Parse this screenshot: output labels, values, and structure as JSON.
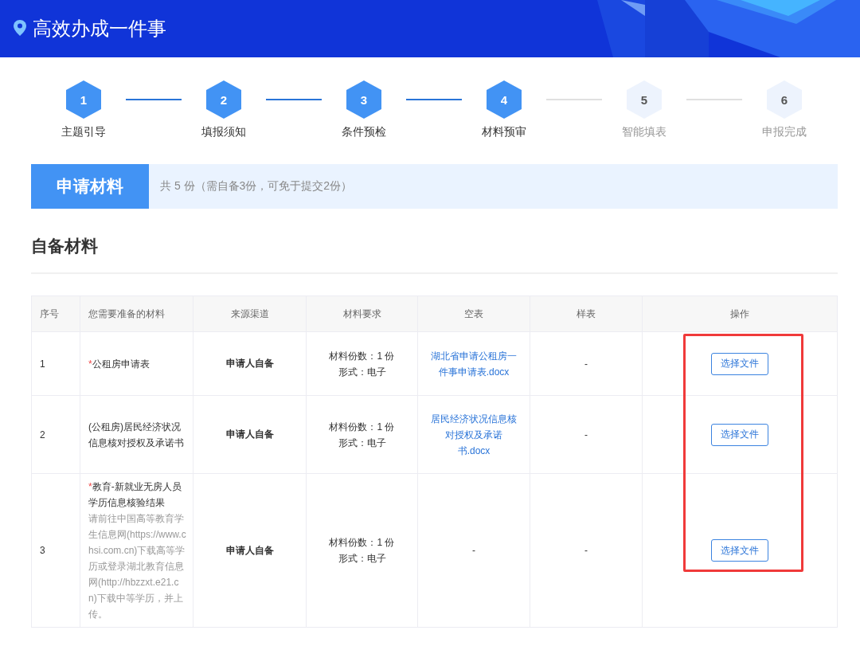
{
  "header": {
    "title": "高效办成一件事"
  },
  "steps": [
    {
      "number": "1",
      "label": "主题引导",
      "done": true
    },
    {
      "number": "2",
      "label": "填报须知",
      "done": true
    },
    {
      "number": "3",
      "label": "条件预检",
      "done": true
    },
    {
      "number": "4",
      "label": "材料预审",
      "done": true
    },
    {
      "number": "5",
      "label": "智能填表",
      "done": false
    },
    {
      "number": "6",
      "label": "申报完成",
      "done": false
    }
  ],
  "section": {
    "tab": "申请材料",
    "summary": "共 5 份（需自备3份，可免于提交2份）"
  },
  "subsection_title": "自备材料",
  "table": {
    "columns": [
      "序号",
      "您需要准备的材料",
      "来源渠道",
      "材料要求",
      "空表",
      "样表",
      "操作"
    ],
    "highlight_actions": true,
    "required_mark": "*",
    "rows": [
      {
        "index": "1",
        "required": true,
        "name": "公租房申请表",
        "note": "",
        "source": "申请人自备",
        "requirement": [
          "材料份数：1 份",
          "形式：电子"
        ],
        "blank_form": {
          "text": "湖北省申请公租房一件事申请表.docx",
          "kind": "link"
        },
        "sample": "-",
        "action": "选择文件"
      },
      {
        "index": "2",
        "required": false,
        "name": " (公租房)居民经济状况信息核对授权及承诺书",
        "note": "",
        "source": "申请人自备",
        "requirement": [
          "材料份数：1 份",
          "形式：电子"
        ],
        "blank_form": {
          "text": "居民经济状况信息核对授权及承诺书.docx",
          "kind": "link"
        },
        "sample": "-",
        "action": "选择文件"
      },
      {
        "index": "3",
        "required": true,
        "name": "教育-新就业无房人员学历信息核验结果",
        "note": "请前往中国高等教育学生信息网(https://www.chsi.com.cn)下载高等学历或登录湖北教育信息网(http://hbzzxt.e21.cn)下载中等学历，并上传。",
        "source": "申请人自备",
        "requirement": [
          "材料份数：1 份",
          "形式：电子"
        ],
        "blank_form": {
          "text": "-",
          "kind": "plain"
        },
        "sample": "-",
        "action": "选择文件"
      }
    ]
  }
}
